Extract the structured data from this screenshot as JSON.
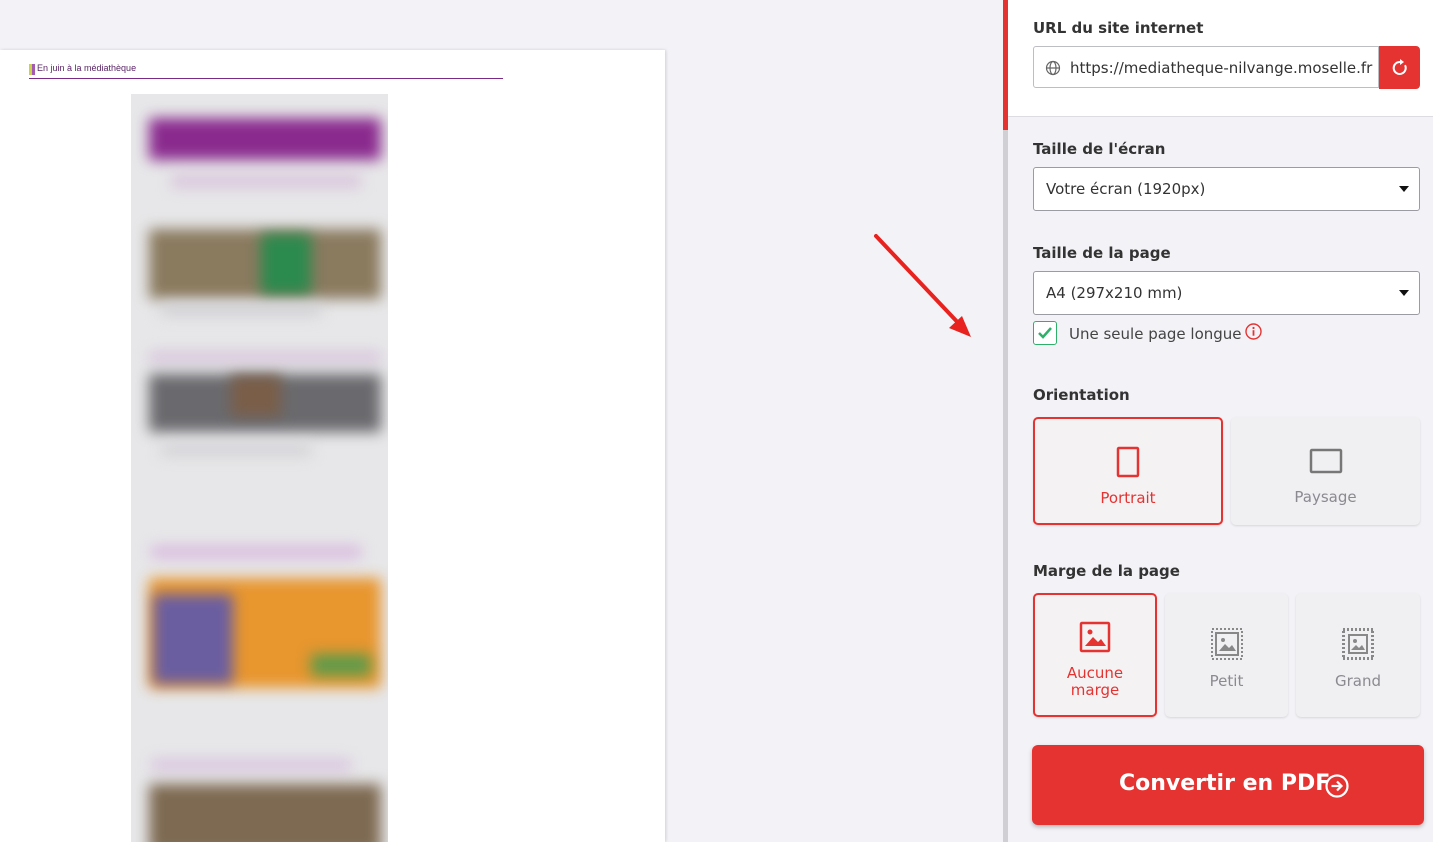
{
  "preview": {
    "header_text": "En juin à la médiathèque"
  },
  "sidebar": {
    "url_label": "URL du site internet",
    "url_value": "https://mediatheque-nilvange.moselle.fr",
    "screen_size_label": "Taille de l'écran",
    "screen_size_value": "Votre écran (1920px)",
    "page_size_label": "Taille de la page",
    "page_size_value": "A4 (297x210 mm)",
    "single_page_label": "Une seule page longue",
    "single_page_checked": true,
    "orientation_label": "Orientation",
    "orientation_options": [
      "Portrait",
      "Paysage"
    ],
    "orientation_selected": "Portrait",
    "margin_label": "Marge de la page",
    "margin_options": [
      "Aucune marge",
      "Petit",
      "Grand"
    ],
    "margin_selected": "Aucune marge",
    "convert_label": "Convertir en PDF"
  },
  "colors": {
    "accent": "#e53331",
    "check": "#2fb06a",
    "header_purple": "#7a2a86"
  }
}
